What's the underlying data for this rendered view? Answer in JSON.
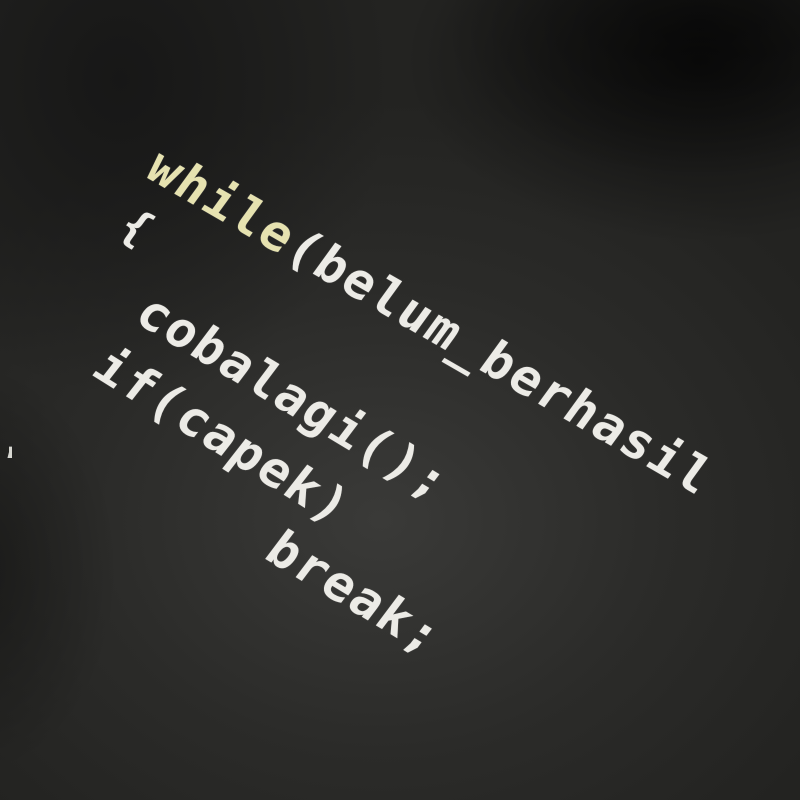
{
  "shirt_print": {
    "lines": [
      {
        "keyword": "while",
        "rest": "(belum_berhasil"
      },
      {
        "text": "{"
      },
      {
        "text": "cobalagi();"
      },
      {
        "text": "if(capek)"
      },
      {
        "text": "break;"
      }
    ]
  },
  "colors": {
    "fabric": "#2b2b29",
    "text": "#ecebe6",
    "keyword": "#e6e2b0"
  }
}
